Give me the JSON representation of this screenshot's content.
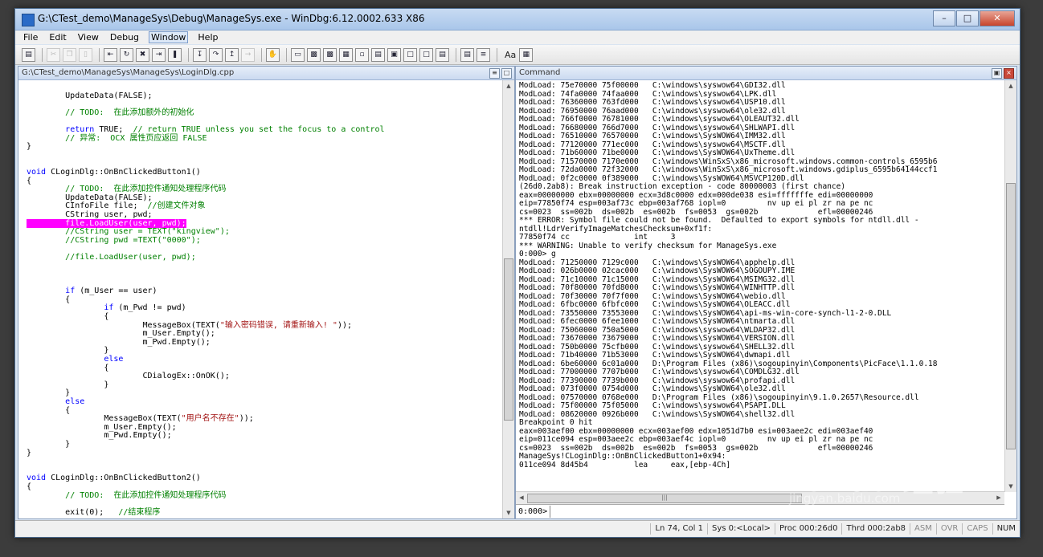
{
  "window": {
    "title": "G:\\CTest_demo\\ManageSys\\Debug\\ManageSys.exe - WinDbg:6.12.0002.633 X86"
  },
  "menu": [
    "File",
    "Edit",
    "View",
    "Debug",
    "Window",
    "Help"
  ],
  "menu_active_index": 4,
  "toolbar": {
    "text_toggle_label": "Aa"
  },
  "source_pane": {
    "title": "G:\\CTest_demo\\ManageSys\\ManageSys\\LoginDlg.cpp",
    "lines": [
      [],
      [
        {
          "t": "        UpdateData(FALSE);"
        }
      ],
      [],
      [
        {
          "t": "        "
        },
        {
          "t": "// TODO:  在此添加额外的初始化",
          "c": "cm"
        }
      ],
      [],
      [
        {
          "t": "        "
        },
        {
          "t": "return",
          "c": "kw"
        },
        {
          "t": " TRUE;  "
        },
        {
          "t": "// return TRUE unless you set the focus to a control",
          "c": "cm"
        }
      ],
      [
        {
          "t": "        "
        },
        {
          "t": "// 异常:  OCX 属性页应返回 FALSE",
          "c": "cm"
        }
      ],
      [
        {
          "t": "}"
        }
      ],
      [],
      [],
      [
        {
          "t": "void",
          "c": "kw"
        },
        {
          "t": " CLoginDlg::OnBnClickedButton1()"
        }
      ],
      [
        {
          "t": "{"
        }
      ],
      [
        {
          "t": "        "
        },
        {
          "t": "// TODO:  在此添加控件通知处理程序代码",
          "c": "cm"
        }
      ],
      [
        {
          "t": "        UpdateData(FALSE);"
        }
      ],
      [
        {
          "t": "        CInfoFile file;  "
        },
        {
          "t": "//创建文件对象",
          "c": "cm"
        }
      ],
      [
        {
          "t": "        CString user, pwd;"
        }
      ],
      [
        {
          "t": "        file.LoadUser(user, pwd);",
          "c": "hl"
        }
      ],
      [
        {
          "t": "        "
        },
        {
          "t": "//CString user = TEXT(\"kingview\");",
          "c": "cm"
        }
      ],
      [
        {
          "t": "        "
        },
        {
          "t": "//CString pwd =TEXT(\"0000\");",
          "c": "cm"
        }
      ],
      [],
      [
        {
          "t": "        "
        },
        {
          "t": "//file.LoadUser(user, pwd);",
          "c": "cm"
        }
      ],
      [],
      [],
      [],
      [
        {
          "t": "        "
        },
        {
          "t": "if",
          "c": "kw"
        },
        {
          "t": " (m_User == user)"
        }
      ],
      [
        {
          "t": "        {"
        }
      ],
      [
        {
          "t": "                "
        },
        {
          "t": "if",
          "c": "kw"
        },
        {
          "t": " (m_Pwd != pwd)"
        }
      ],
      [
        {
          "t": "                {"
        }
      ],
      [
        {
          "t": "                        MessageBox(TEXT("
        },
        {
          "t": "\"输入密码错误, 请重新输入! \"",
          "c": "st"
        },
        {
          "t": "));"
        }
      ],
      [
        {
          "t": "                        m_User.Empty();"
        }
      ],
      [
        {
          "t": "                        m_Pwd.Empty();"
        }
      ],
      [
        {
          "t": "                }"
        }
      ],
      [
        {
          "t": "                "
        },
        {
          "t": "else",
          "c": "kw"
        }
      ],
      [
        {
          "t": "                {"
        }
      ],
      [
        {
          "t": "                        CDialogEx::OnOK();"
        }
      ],
      [
        {
          "t": "                }"
        }
      ],
      [
        {
          "t": "        }"
        }
      ],
      [
        {
          "t": "        "
        },
        {
          "t": "else",
          "c": "kw"
        }
      ],
      [
        {
          "t": "        {"
        }
      ],
      [
        {
          "t": "                MessageBox(TEXT("
        },
        {
          "t": "\"用户名不存在\"",
          "c": "st"
        },
        {
          "t": "));"
        }
      ],
      [
        {
          "t": "                m_User.Empty();"
        }
      ],
      [
        {
          "t": "                m_Pwd.Empty();"
        }
      ],
      [
        {
          "t": "        }"
        }
      ],
      [
        {
          "t": "}"
        }
      ],
      [],
      [],
      [
        {
          "t": "void",
          "c": "kw"
        },
        {
          "t": " CLoginDlg::OnBnClickedButton2()"
        }
      ],
      [
        {
          "t": "{"
        }
      ],
      [
        {
          "t": "        "
        },
        {
          "t": "// TODO:  在此添加控件通知处理程序代码",
          "c": "cm"
        }
      ],
      [],
      [
        {
          "t": "        exit(0);   "
        },
        {
          "t": "//结束程序",
          "c": "cm"
        }
      ]
    ]
  },
  "command_pane": {
    "title": "Command",
    "prompt": "0:000>",
    "lines": [
      "ModLoad: 75e70000 75f00000   C:\\windows\\syswow64\\GDI32.dll",
      "ModLoad: 74fa0000 74faa000   C:\\windows\\syswow64\\LPK.dll",
      "ModLoad: 76360000 763fd000   C:\\windows\\syswow64\\USP10.dll",
      "ModLoad: 76950000 76aad000   C:\\windows\\syswow64\\ole32.dll",
      "ModLoad: 766f0000 76781000   C:\\windows\\syswow64\\OLEAUT32.dll",
      "ModLoad: 76680000 766d7000   C:\\windows\\syswow64\\SHLWAPI.dll",
      "ModLoad: 76510000 76570000   C:\\windows\\SysWOW64\\IMM32.dll",
      "ModLoad: 77120000 771ec000   C:\\windows\\syswow64\\MSCTF.dll",
      "ModLoad: 71b60000 71be0000   C:\\windows\\SysWOW64\\UxTheme.dll",
      "ModLoad: 71570000 7170e000   C:\\windows\\WinSxS\\x86_microsoft.windows.common-controls_6595b6",
      "ModLoad: 72da0000 72f32000   C:\\windows\\WinSxS\\x86_microsoft.windows.gdiplus_6595b64144ccf1",
      "ModLoad: 0f2c0000 0f389000   C:\\windows\\SysWOW64\\MSVCP120D.dll",
      "(26d0.2ab8): Break instruction exception - code 80000003 (first chance)",
      "eax=00000000 ebx=00000000 ecx=3d8c0000 edx=000de038 esi=fffffffe edi=00000000",
      "eip=77850f74 esp=003af73c ebp=003af768 iopl=0         nv up ei pl zr na pe nc",
      "cs=0023  ss=002b  ds=002b  es=002b  fs=0053  gs=002b             efl=00000246",
      "*** ERROR: Symbol file could not be found.  Defaulted to export symbols for ntdll.dll -",
      "ntdll!LdrVerifyImageMatchesChecksum+0xf1f:",
      "77850f74 cc              int     3",
      "*** WARNING: Unable to verify checksum for ManageSys.exe",
      "0:000> g",
      "ModLoad: 71250000 7129c000   C:\\windows\\SysWOW64\\apphelp.dll",
      "ModLoad: 026b0000 02cac000   C:\\windows\\SysWOW64\\SOGOUPY.IME",
      "ModLoad: 71c10000 71c15000   C:\\windows\\SysWOW64\\MSIMG32.dll",
      "ModLoad: 70f80000 70fd8000   C:\\windows\\SysWOW64\\WINHTTP.dll",
      "ModLoad: 70f30000 70f7f000   C:\\windows\\SysWOW64\\webio.dll",
      "ModLoad: 6fbc0000 6fbfc000   C:\\windows\\SysWOW64\\OLEACC.dll",
      "ModLoad: 73550000 73553000   C:\\windows\\SysWOW64\\api-ms-win-core-synch-l1-2-0.DLL",
      "ModLoad: 6fec0000 6fee1000   C:\\windows\\SysWOW64\\ntmarta.dll",
      "ModLoad: 75060000 750a5000   C:\\windows\\syswow64\\WLDAP32.dll",
      "ModLoad: 73670000 73679000   C:\\windows\\SysWOW64\\VERSION.dll",
      "ModLoad: 750b0000 75cfb000   C:\\windows\\syswow64\\SHELL32.dll",
      "ModLoad: 71b40000 71b53000   C:\\windows\\SysWOW64\\dwmapi.dll",
      "ModLoad: 6be60000 6c01a000   D:\\Program Files (x86)\\sogoupinyin\\Components\\PicFace\\1.1.0.18",
      "ModLoad: 77000000 7707b000   C:\\windows\\syswow64\\COMDLG32.dll",
      "ModLoad: 77390000 7739b000   C:\\windows\\syswow64\\profapi.dll",
      "ModLoad: 073f0000 0754d000   C:\\windows\\SysWOW64\\ole32.dll",
      "ModLoad: 07570000 0768e000   D:\\Program Files (x86)\\sogoupinyin\\9.1.0.2657\\Resource.dll",
      "ModLoad: 75f00000 75f05000   C:\\windows\\syswow64\\PSAPI.DLL",
      "ModLoad: 08620000 0926b000   C:\\windows\\SysWOW64\\shell32.dll",
      "Breakpoint 0 hit",
      "eax=003aef00 ebx=00000000 ecx=003aef00 edx=1051d7b0 esi=003aee2c edi=003aef40",
      "eip=011ce094 esp=003aee2c ebp=003aef4c iopl=0         nv up ei pl zr na pe nc",
      "cs=0023  ss=002b  ds=002b  es=002b  fs=0053  gs=002b             efl=00000246",
      "ManageSys!CLoginDlg::OnBnClickedButton1+0x94:",
      "011ce094 8d45b4          lea     eax,[ebp-4Ch]"
    ]
  },
  "status": {
    "cells": [
      {
        "label": "Ln 74, Col 1",
        "on": true
      },
      {
        "label": "Sys 0:<Local>",
        "on": true
      },
      {
        "label": "Proc 000:26d0",
        "on": true
      },
      {
        "label": "Thrd 000:2ab8",
        "on": true
      },
      {
        "label": "ASM",
        "on": false
      },
      {
        "label": "OVR",
        "on": false
      },
      {
        "label": "CAPS",
        "on": false
      },
      {
        "label": "NUM",
        "on": true
      }
    ]
  },
  "watermark": {
    "text": "Bai du 经验",
    "url": "jingyan.baidu.com"
  }
}
